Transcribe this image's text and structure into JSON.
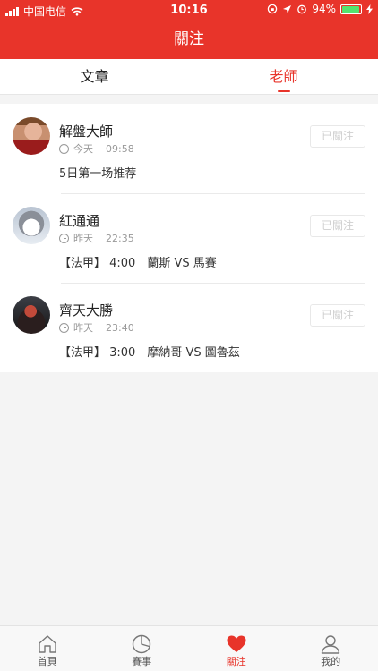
{
  "status_bar": {
    "carrier": "中国电信",
    "time": "10:16",
    "battery": "94%",
    "battery_level": 0.94
  },
  "navbar": {
    "title": "關注"
  },
  "tabs": [
    {
      "label": "文章",
      "active": false
    },
    {
      "label": "老師",
      "active": true
    }
  ],
  "teachers": [
    {
      "name": "解盤大師",
      "day": "今天",
      "time": "09:58",
      "follow_label": "已關注",
      "summary": "5日第一场推荐"
    },
    {
      "name": "紅通通",
      "day": "昨天",
      "time": "22:35",
      "follow_label": "已關注",
      "summary": "【法甲】 4:00　蘭斯 VS 馬賽"
    },
    {
      "name": "齊天大勝",
      "day": "昨天",
      "time": "23:40",
      "follow_label": "已關注",
      "summary": "【法甲】 3:00　摩納哥 VS 圖魯茲"
    }
  ],
  "bottom_tabs": [
    {
      "label": "首頁",
      "icon": "home-icon",
      "active": false
    },
    {
      "label": "賽事",
      "icon": "schedule-icon",
      "active": false
    },
    {
      "label": "關注",
      "icon": "heart-icon",
      "active": true
    },
    {
      "label": "我的",
      "icon": "profile-icon",
      "active": false
    }
  ],
  "colors": {
    "brand": "#e8342a",
    "background": "#f4f4f4",
    "battery_fill": "#54e36e"
  }
}
